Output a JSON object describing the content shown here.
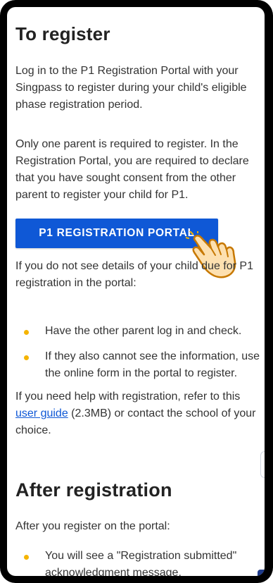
{
  "section_register": {
    "heading": "To register",
    "para1": "Log in to the P1 Registration Portal with your Singpass to register during your child's eligible phase registration period.",
    "para2": "Only one parent is required to register. In the Registration Portal, you are required to declare that you have sought consent from the other parent to register your child for P1.",
    "button_label": "P1 REGISTRATION PORTAL",
    "para3": "If you do not see details of your child due for P1 registration in the portal:",
    "bullets": [
      "Have the other parent log in and check.",
      "If they also cannot see the information, use the online form in the portal to register."
    ],
    "help_prefix": "If you need help with registration, refer to this ",
    "help_link": "user guide",
    "help_suffix": " (2.3MB) or contact the school of your choice."
  },
  "section_after": {
    "heading": "After registration",
    "para1": "After you register on the portal:",
    "bullets": [
      "You will see a \"Registration submitted\" acknowledgment message."
    ]
  },
  "icons": {
    "scroll_top": "chevron-up-icon",
    "pointer": "hand-pointer-icon"
  },
  "colors": {
    "primary": "#0f58d6",
    "bullet": "#f5b400",
    "heading": "#222222"
  }
}
